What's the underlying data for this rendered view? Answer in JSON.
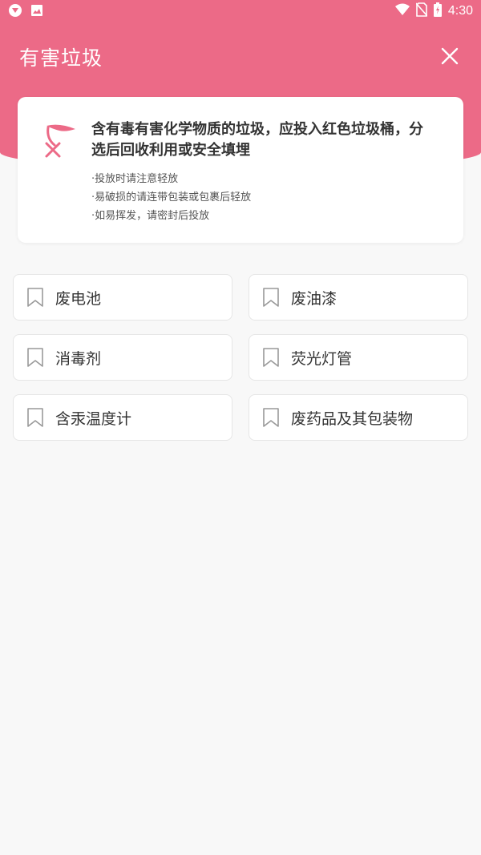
{
  "status_bar": {
    "time": "4:30",
    "icons": [
      "app-icon",
      "image-icon",
      "wifi-icon",
      "no-sim-icon",
      "battery-icon"
    ]
  },
  "header": {
    "title": "有害垃圾",
    "close_icon": "close-icon",
    "background_color": "#ec6a87"
  },
  "card": {
    "icon": "hazardous-waste-icon",
    "description": "含有毒有害化学物质的垃圾，应投入红色垃圾桶，分选后回收利用或安全填埋",
    "tips": [
      "·投放时请注意轻放",
      "·易破损的请连带包装或包裹后轻放",
      "·如易挥发，请密封后投放"
    ]
  },
  "items": [
    {
      "label": "废电池",
      "icon": "bookmark-icon"
    },
    {
      "label": "废油漆",
      "icon": "bookmark-icon"
    },
    {
      "label": "消毒剂",
      "icon": "bookmark-icon"
    },
    {
      "label": "荧光灯管",
      "icon": "bookmark-icon"
    },
    {
      "label": "含汞温度计",
      "icon": "bookmark-icon"
    },
    {
      "label": "废药品及其包装物",
      "icon": "bookmark-icon"
    }
  ]
}
